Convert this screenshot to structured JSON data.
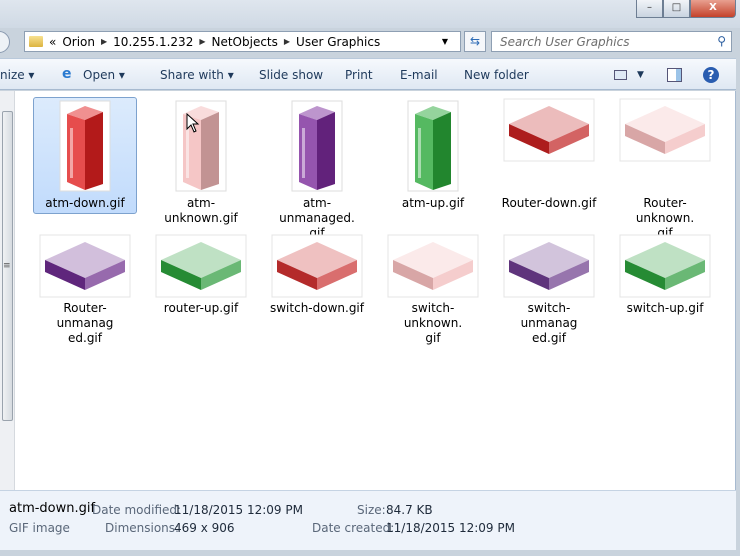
{
  "window": {
    "minimize": "–",
    "maximize": "□",
    "close": "X"
  },
  "address": {
    "overflow": "«",
    "crumbs": [
      "Orion",
      "10.255.1.232",
      "NetObjects",
      "User Graphics"
    ]
  },
  "search": {
    "placeholder": "Search User Graphics"
  },
  "toolbar": {
    "organize": "nize ▾",
    "open": "Open",
    "share": "Share with ▾",
    "slideshow": "Slide show",
    "print": "Print",
    "email": "E-mail",
    "newfolder": "New folder"
  },
  "items": [
    {
      "name": "atm-down.gif",
      "type": "atm",
      "color": "#e02020",
      "selected": true
    },
    {
      "name": "atm-unknown.gif",
      "type": "atm",
      "color": "#f2b8b8"
    },
    {
      "name": "atm-unmanaged.gif",
      "type": "atm",
      "color": "#7a2a9a"
    },
    {
      "name": "atm-up.gif",
      "type": "atm",
      "color": "#2aa83a"
    },
    {
      "name": "Router-down.gif",
      "type": "slab",
      "color": "#c02020"
    },
    {
      "name": "Router-unknown.gif",
      "type": "slab",
      "color": "#f0b8b8"
    },
    {
      "name": "Router-unmanaged.gif",
      "type": "slab",
      "color": "#6a2a8a"
    },
    {
      "name": "router-up.gif",
      "type": "slab",
      "color": "#2a9a3a"
    },
    {
      "name": "switch-down.gif",
      "type": "slab",
      "color": "#c83030"
    },
    {
      "name": "switch-unknown.gif",
      "type": "slab",
      "color": "#f0b8b8"
    },
    {
      "name": "switch-unmanaged.gif",
      "type": "slab",
      "color": "#6a3a8a"
    },
    {
      "name": "switch-up.gif",
      "type": "slab",
      "color": "#2a9a3a"
    }
  ],
  "labels_wrapped": [
    "atm-down.gif",
    "atm-unknown.gif",
    "atm-unmanaged.\ngif",
    "atm-up.gif",
    "Router-down.gif",
    "Router-unknown.\ngif",
    "Router-unmanag\ned.gif",
    "router-up.gif",
    "switch-down.gif",
    "switch-unknown.\ngif",
    "switch-unmanag\ned.gif",
    "switch-up.gif"
  ],
  "status": {
    "filename": "atm-down.gif",
    "type": "GIF image",
    "modified_label": "Date modified:",
    "modified": "11/18/2015 12:09 PM",
    "size_label": "Size:",
    "size": "84.7 KB",
    "dims_label": "Dimensions:",
    "dims": "469 x 906",
    "created_label": "Date created:",
    "created": "11/18/2015 12:09 PM"
  }
}
